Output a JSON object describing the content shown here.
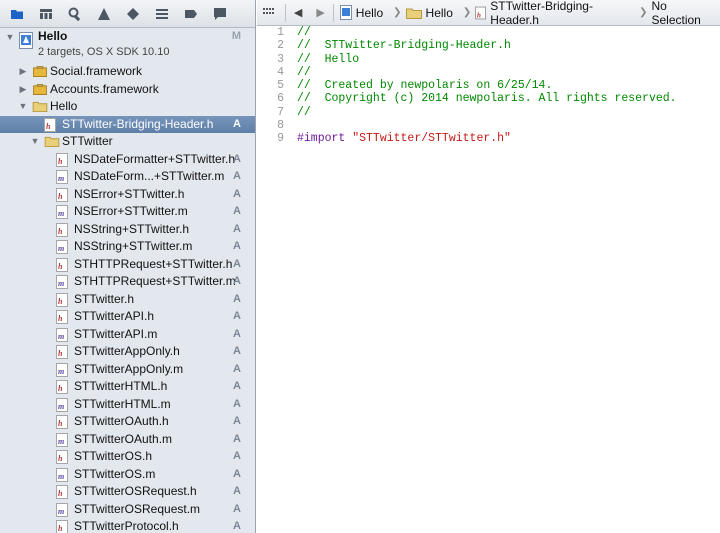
{
  "navigator_toolbar": {
    "buttons": [
      "project-navigator-icon",
      "symbol-navigator-icon",
      "search-navigator-icon",
      "issue-navigator-icon",
      "test-navigator-icon",
      "debug-navigator-icon",
      "breakpoint-navigator-icon",
      "log-navigator-icon"
    ]
  },
  "project": {
    "name": "Hello",
    "subtitle": "2 targets, OS X SDK 10.10",
    "badge": "M"
  },
  "tree": [
    {
      "label": "Social.framework",
      "kind": "framework",
      "expanded": false,
      "badge": ""
    },
    {
      "label": "Accounts.framework",
      "kind": "framework",
      "expanded": false,
      "badge": ""
    },
    {
      "label": "Hello",
      "kind": "folder",
      "expanded": true,
      "badge": ""
    },
    {
      "label": "STTwitter-Bridging-Header.h",
      "kind": "h",
      "selected": true,
      "badge": "A"
    },
    {
      "label": "STTwitter",
      "kind": "folder",
      "expanded": true,
      "badge": ""
    },
    {
      "label": "NSDateFormatter+STTwitter.h",
      "kind": "h",
      "badge": "A"
    },
    {
      "label": "NSDateForm...+STTwitter.m",
      "kind": "m",
      "badge": "A"
    },
    {
      "label": "NSError+STTwitter.h",
      "kind": "h",
      "badge": "A"
    },
    {
      "label": "NSError+STTwitter.m",
      "kind": "m",
      "badge": "A"
    },
    {
      "label": "NSString+STTwitter.h",
      "kind": "h",
      "badge": "A"
    },
    {
      "label": "NSString+STTwitter.m",
      "kind": "m",
      "badge": "A"
    },
    {
      "label": "STHTTPRequest+STTwitter.h",
      "kind": "h",
      "badge": "A"
    },
    {
      "label": "STHTTPRequest+STTwitter.m",
      "kind": "m",
      "badge": "A"
    },
    {
      "label": "STTwitter.h",
      "kind": "h",
      "badge": "A"
    },
    {
      "label": "STTwitterAPI.h",
      "kind": "h",
      "badge": "A"
    },
    {
      "label": "STTwitterAPI.m",
      "kind": "m",
      "badge": "A"
    },
    {
      "label": "STTwitterAppOnly.h",
      "kind": "h",
      "badge": "A"
    },
    {
      "label": "STTwitterAppOnly.m",
      "kind": "m",
      "badge": "A"
    },
    {
      "label": "STTwitterHTML.h",
      "kind": "h",
      "badge": "A"
    },
    {
      "label": "STTwitterHTML.m",
      "kind": "m",
      "badge": "A"
    },
    {
      "label": "STTwitterOAuth.h",
      "kind": "h",
      "badge": "A"
    },
    {
      "label": "STTwitterOAuth.m",
      "kind": "m",
      "badge": "A"
    },
    {
      "label": "STTwitterOS.h",
      "kind": "h",
      "badge": "A"
    },
    {
      "label": "STTwitterOS.m",
      "kind": "m",
      "badge": "A"
    },
    {
      "label": "STTwitterOSRequest.h",
      "kind": "h",
      "badge": "A"
    },
    {
      "label": "STTwitterOSRequest.m",
      "kind": "m",
      "badge": "A"
    },
    {
      "label": "STTwitterProtocol.h",
      "kind": "h",
      "badge": "A"
    }
  ],
  "jump_bar": {
    "crumbs": [
      "Hello",
      "Hello",
      "STTwitter-Bridging-Header.h",
      "No Selection"
    ]
  },
  "code": [
    {
      "n": "1",
      "parts": [
        {
          "t": "//",
          "c": "comment"
        }
      ]
    },
    {
      "n": "2",
      "parts": [
        {
          "t": "//  STTwitter-Bridging-Header.h",
          "c": "comment"
        }
      ]
    },
    {
      "n": "3",
      "parts": [
        {
          "t": "//  Hello",
          "c": "comment"
        }
      ]
    },
    {
      "n": "4",
      "parts": [
        {
          "t": "//",
          "c": "comment"
        }
      ]
    },
    {
      "n": "5",
      "parts": [
        {
          "t": "//  Created by newpolaris on 6/25/14.",
          "c": "comment"
        }
      ]
    },
    {
      "n": "6",
      "parts": [
        {
          "t": "//  Copyright (c) 2014 newpolaris. All rights reserved.",
          "c": "comment"
        }
      ]
    },
    {
      "n": "7",
      "parts": [
        {
          "t": "//",
          "c": "comment"
        }
      ]
    },
    {
      "n": "8",
      "parts": []
    },
    {
      "n": "9",
      "parts": [
        {
          "t": "#import ",
          "c": "keyword"
        },
        {
          "t": "\"STTwitter/STTwitter.h\"",
          "c": "string"
        }
      ]
    }
  ]
}
